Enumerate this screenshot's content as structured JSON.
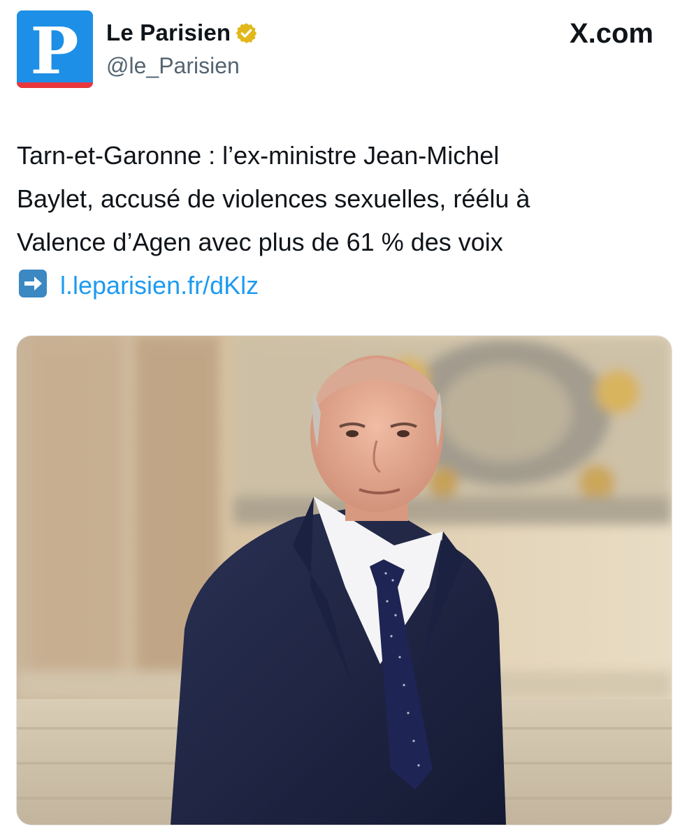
{
  "account": {
    "display_name": "Le Parisien",
    "handle": "@le_Parisien",
    "avatar_letter": "P",
    "verified": true
  },
  "brand": {
    "watermark": "X.com"
  },
  "tweet": {
    "lines": [
      "Tarn-et-Garonne : l’ex-ministre Jean-Michel",
      "Baylet, accusé de violences sexuelles, réélu à",
      "Valence d’Agen avec plus de 61 % des voix"
    ],
    "link_emoji": "arrow-right-emoji",
    "link_text": "l.leparisien.fr/dKlz"
  },
  "media": {
    "type": "photo"
  },
  "colors": {
    "link": "#1d9bf0",
    "avatar_blue": "#1d8fe6",
    "avatar_red": "#e8363b",
    "verified_gold": "#e2b719",
    "handle_gray": "#536471"
  }
}
